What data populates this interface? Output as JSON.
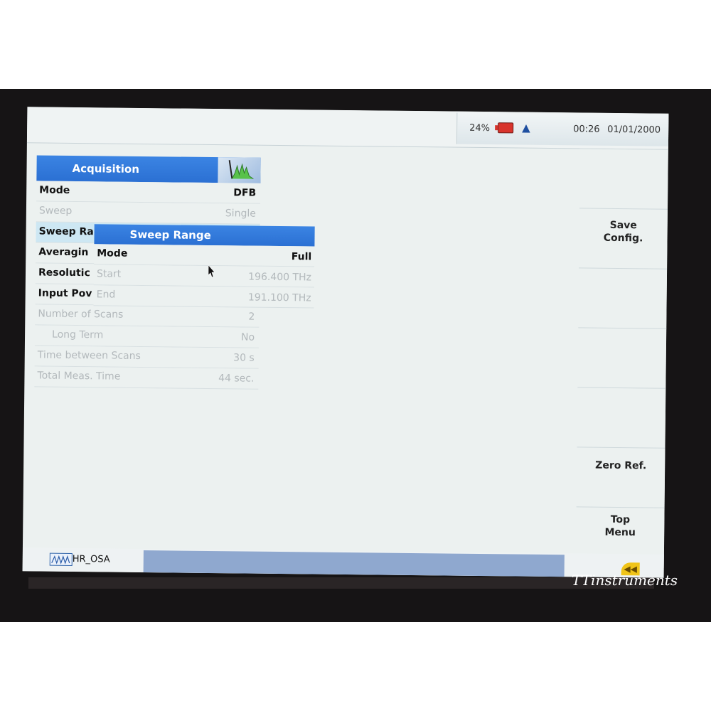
{
  "status": {
    "battery_percent": "24%",
    "time": "00:26",
    "date": "01/01/2000"
  },
  "acquisition": {
    "title": "Acquisition",
    "rows": [
      {
        "label": "Mode",
        "value": "DFB"
      },
      {
        "label": "Sweep",
        "value": "Single"
      },
      {
        "label": "Sweep Ra",
        "value": ""
      },
      {
        "label": "Averagin",
        "value": ""
      },
      {
        "label": "Resolutic",
        "value": ""
      },
      {
        "label": "Input Pov",
        "value": ""
      },
      {
        "label": "Number of Scans",
        "value": "2"
      },
      {
        "label": "Long Term",
        "value": "No"
      },
      {
        "label": "Time between Scans",
        "value": "30 s"
      },
      {
        "label": "Total Meas. Time",
        "value": "44 sec."
      }
    ]
  },
  "sweep_range": {
    "title": "Sweep Range",
    "rows": [
      {
        "label": "Mode",
        "value": "Full"
      },
      {
        "label": "Start",
        "value": "196.400 THz"
      },
      {
        "label": "End",
        "value": "191.100 THz"
      }
    ]
  },
  "softkeys": {
    "save_line1": "Save",
    "save_line2": "Config.",
    "zero_ref": "Zero Ref.",
    "top_line1": "Top",
    "top_line2": "Menu"
  },
  "app_tab": {
    "label": "HR_OSA",
    "icon": "spectrum-icon"
  },
  "watermark": "TTinstruments"
}
